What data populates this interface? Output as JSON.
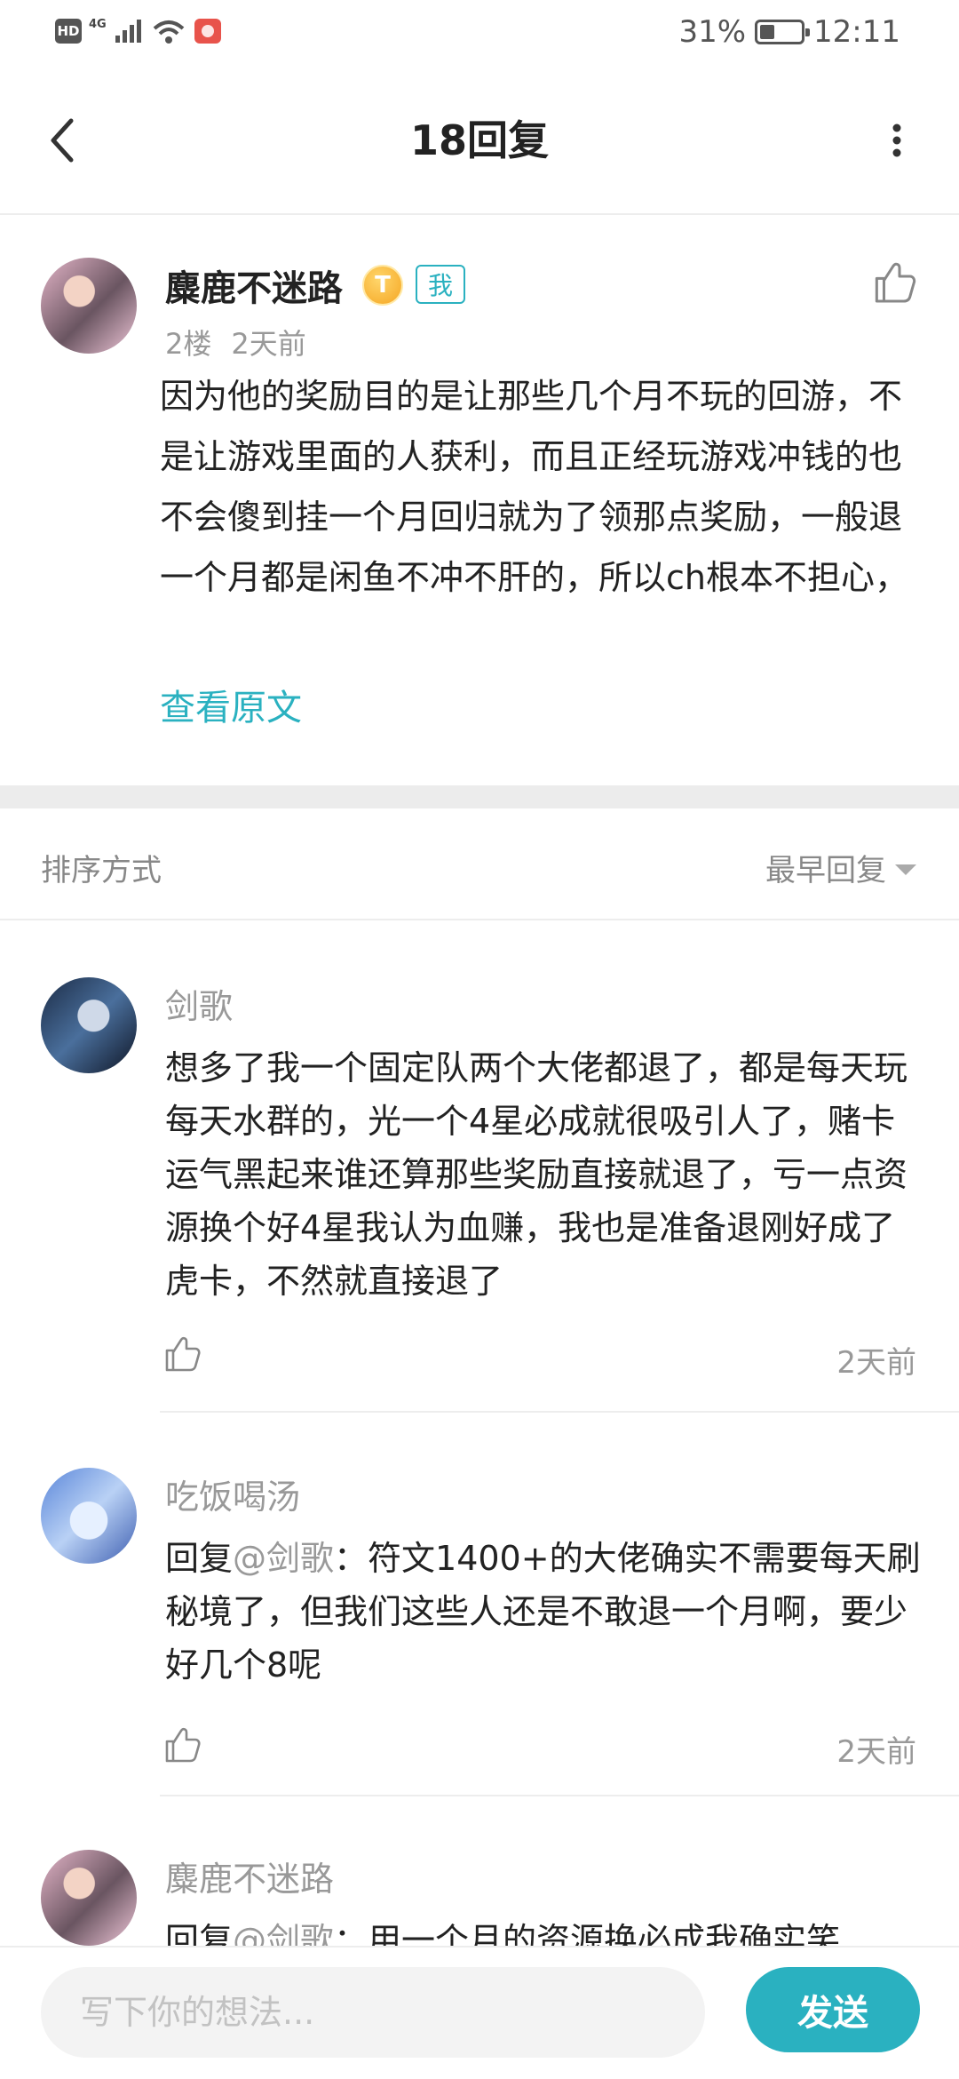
{
  "status_bar": {
    "hd": "HD",
    "network": "4G",
    "battery": "31%",
    "time": "12:11",
    "battery_level": 0.31
  },
  "header": {
    "title": "18回复",
    "back_icon": "back-arrow-icon",
    "more_icon": "more-vertical-icon"
  },
  "post": {
    "author": "麋鹿不迷路",
    "level_badge": "T",
    "me_tag": "我",
    "floor": "2楼",
    "time": "2天前",
    "content": "因为他的奖励目的是让那些几个月不玩的回游，不是让游戏里面的人获利，而且正经玩游戏冲钱的也不会傻到挂一个月回归就为了领那点奖励，一般退一个月都是闲鱼不冲不肝的，所以ch根本不担心，",
    "view_original": "查看原文"
  },
  "sort": {
    "label": "排序方式",
    "selected": "最早回复"
  },
  "replies": [
    {
      "author": "剑歌",
      "reply_to_label": "",
      "mention": "",
      "content": "想多了我一个固定队两个大佬都退了，都是每天玩每天水群的，光一个4星必成就很吸引人了，赌卡运气黑起来谁还算那些奖励直接就退了，亏一点资源换个好4星我认为血赚，我也是准备退刚好成了虎卡，不然就直接退了",
      "time": "2天前"
    },
    {
      "author": "吃饭喝汤",
      "reply_to_label": "回复",
      "mention": "@剑歌",
      "content": "：符文1400+的大佬确实不需要每天刷秘境了，但我们这些人还是不敢退一个月啊，要少好几个8呢",
      "time": "2天前"
    },
    {
      "author": "麋鹿不迷路",
      "reply_to_label": "回复",
      "mention": "@剑歌",
      "content": "：用一个月的资源换必成我确实笑",
      "time": ""
    }
  ],
  "composer": {
    "placeholder": "写下你的想法...",
    "send_label": "发送"
  },
  "colors": {
    "accent": "#2ab1c0",
    "muted": "#999999"
  }
}
